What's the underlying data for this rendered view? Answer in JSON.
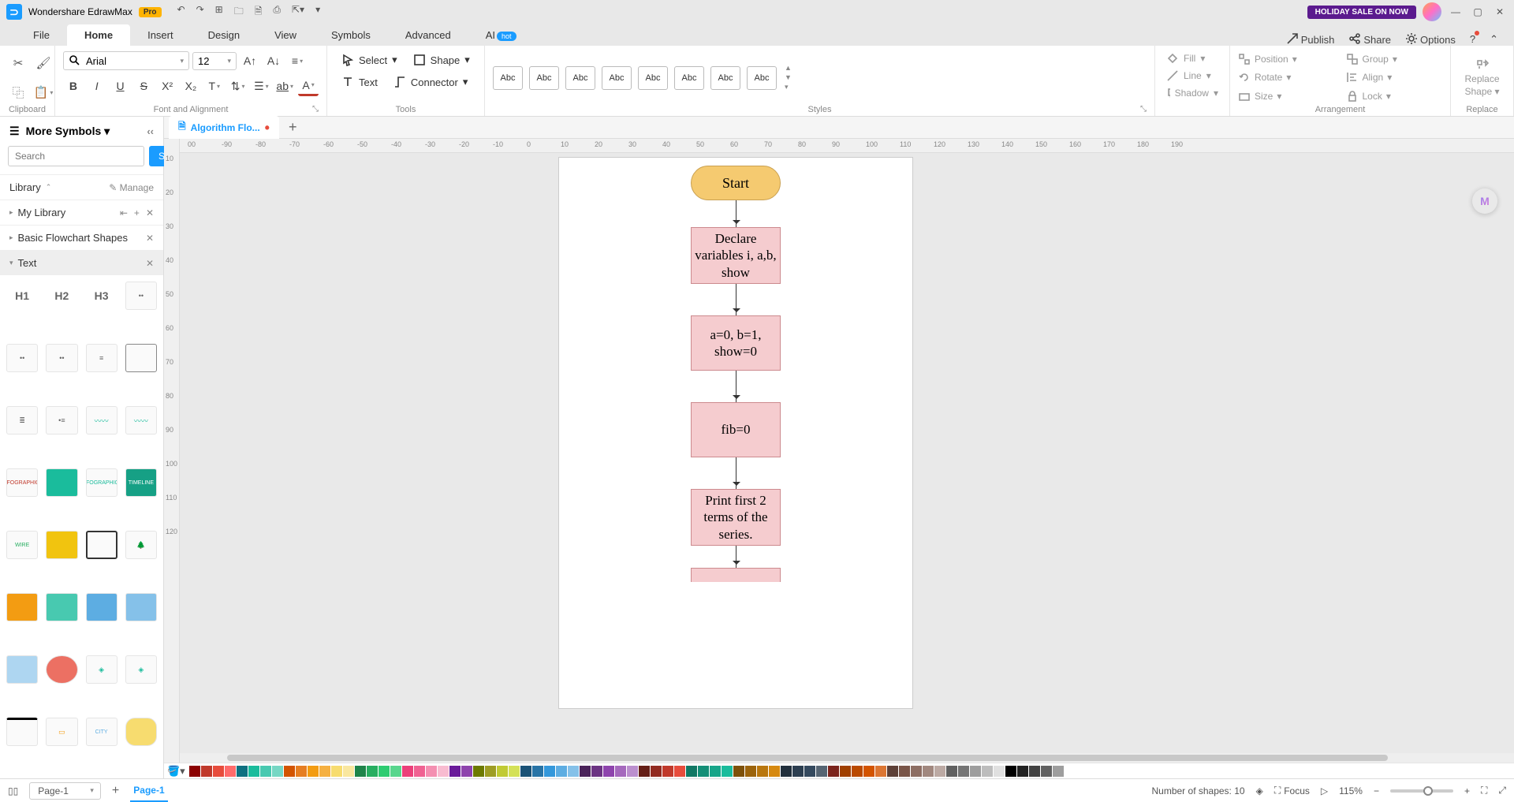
{
  "titlebar": {
    "app_name": "Wondershare EdrawMax",
    "pro": "Pro",
    "sale": "HOLIDAY SALE ON NOW"
  },
  "menu": {
    "tabs": [
      "File",
      "Home",
      "Insert",
      "Design",
      "View",
      "Symbols",
      "Advanced",
      "AI"
    ],
    "hot": "hot",
    "publish": "Publish",
    "share": "Share",
    "options": "Options"
  },
  "ribbon": {
    "clipboard": "Clipboard",
    "font": {
      "label": "Font and Alignment",
      "name": "Arial",
      "size": "12"
    },
    "tools": {
      "label": "Tools",
      "select": "Select",
      "shape": "Shape",
      "text": "Text",
      "connector": "Connector"
    },
    "styles": {
      "label": "Styles",
      "abc": "Abc"
    },
    "linefill": {
      "fill": "Fill",
      "line": "Line",
      "shadow": "Shadow"
    },
    "arrange": {
      "label": "Arrangement",
      "position": "Position",
      "group": "Group",
      "rotate": "Rotate",
      "align": "Align",
      "size": "Size",
      "lock": "Lock"
    },
    "replace": {
      "line1": "Replace",
      "line2": "Shape",
      "label": "Replace"
    }
  },
  "left": {
    "title": "More Symbols",
    "search_placeholder": "Search",
    "search_btn": "Search",
    "library": "Library",
    "manage": "Manage",
    "mylib": "My Library",
    "basic": "Basic Flowchart Shapes",
    "text": "Text",
    "h1": "H1",
    "h2": "H2",
    "h3": "H3"
  },
  "doc": {
    "tab": "Algorithm Flo..."
  },
  "hruler": [
    "00",
    "-90",
    "-80",
    "-70",
    "-60",
    "-50",
    "-40",
    "-30",
    "-20",
    "-10",
    "0",
    "10",
    "20",
    "30",
    "40",
    "50",
    "60",
    "70",
    "80",
    "90",
    "100",
    "110",
    "120",
    "130",
    "140",
    "150",
    "160",
    "170",
    "180",
    "190"
  ],
  "vruler": [
    "10",
    "20",
    "30",
    "40",
    "50",
    "60",
    "70",
    "80",
    "90",
    "100",
    "110",
    "120"
  ],
  "flowchart": {
    "start": "Start",
    "b1": "Declare variables i, a,b, show",
    "b2": "a=0, b=1, show=0",
    "b3": "fib=0",
    "b4": "Print first 2 terms of the series."
  },
  "colors": [
    "#8b0000",
    "#c0392b",
    "#e74c3c",
    "#ff6b6b",
    "#0e7080",
    "#1abc9c",
    "#48c9b0",
    "#76d7c4",
    "#d35400",
    "#e67e22",
    "#f39c12",
    "#f5b041",
    "#f7dc6f",
    "#f9e79f",
    "#1e8449",
    "#27ae60",
    "#2ecc71",
    "#58d68d",
    "#ec407a",
    "#f06292",
    "#f48fb1",
    "#f8bbd0",
    "#6a1b9a",
    "#8e44ad",
    "#6d7a00",
    "#9e9d24",
    "#c0ca33",
    "#d4e157",
    "#1a5276",
    "#2874a6",
    "#3498db",
    "#5dade2",
    "#85c1e9",
    "#4a235a",
    "#6c3483",
    "#8e44ad",
    "#a569bd",
    "#bb8fce",
    "#641e16",
    "#922b21",
    "#c0392b",
    "#e74c3c",
    "#117864",
    "#148f77",
    "#17a589",
    "#1abc9c",
    "#7e5109",
    "#9c640c",
    "#b9770e",
    "#d68910",
    "#212f3c",
    "#2c3e50",
    "#34495e",
    "#566573",
    "#7b241c",
    "#a04000",
    "#ba4a00",
    "#d35400",
    "#dc7633",
    "#5d4037",
    "#795548",
    "#8d6e63",
    "#a1887f",
    "#bcaaa4",
    "#616161",
    "#757575",
    "#9e9e9e",
    "#bdbdbd",
    "#e0e0e0",
    "#000000",
    "#212121",
    "#424242",
    "#616161",
    "#9e9e9e",
    "#ffffff"
  ],
  "status": {
    "page_sel": "Page-1",
    "active_page": "Page-1",
    "shapes": "Number of shapes: 10",
    "focus": "Focus",
    "zoom": "115%"
  }
}
